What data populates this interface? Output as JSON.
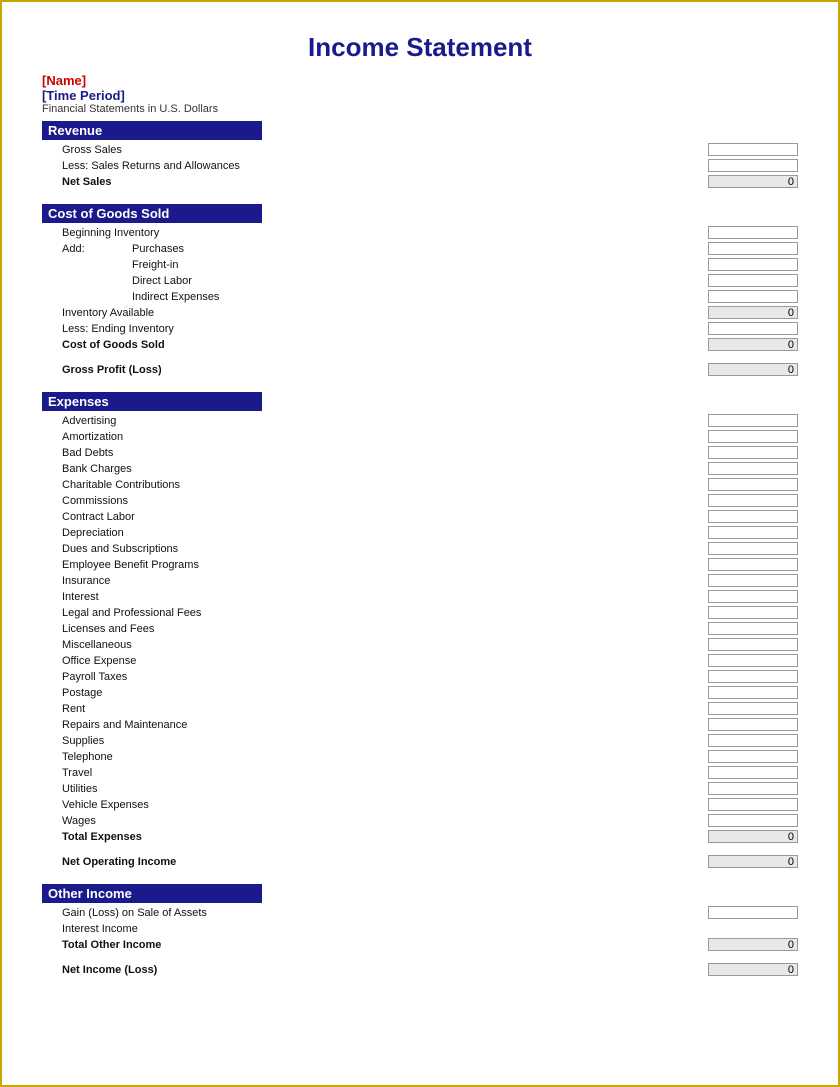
{
  "title": "Income Statement",
  "name_placeholder": "[Name]",
  "time_period_placeholder": "[Time Period]",
  "subtitle": "Financial Statements in U.S. Dollars",
  "sections": {
    "revenue": {
      "header": "Revenue",
      "items": [
        "Gross Sales",
        "Less: Sales Returns and Allowances"
      ],
      "total_label": "Net Sales",
      "total_value": "0"
    },
    "cogs": {
      "header": "Cost of Goods Sold",
      "beginning": "Beginning Inventory",
      "add_label": "Add:",
      "add_items": [
        "Purchases",
        "Freight-in",
        "Direct Labor",
        "Indirect Expenses"
      ],
      "inventory_available": "Inventory Available",
      "inventory_available_value": "0",
      "less_ending": "Less: Ending Inventory",
      "total_label": "Cost of Goods Sold",
      "total_value": "0",
      "gross_profit_label": "Gross Profit (Loss)",
      "gross_profit_value": "0"
    },
    "expenses": {
      "header": "Expenses",
      "items": [
        "Advertising",
        "Amortization",
        "Bad Debts",
        "Bank Charges",
        "Charitable Contributions",
        "Commissions",
        "Contract Labor",
        "Depreciation",
        "Dues and Subscriptions",
        "Employee Benefit Programs",
        "Insurance",
        "Interest",
        "Legal and Professional Fees",
        "Licenses and Fees",
        "Miscellaneous",
        "Office Expense",
        "Payroll Taxes",
        "Postage",
        "Rent",
        "Repairs and Maintenance",
        "Supplies",
        "Telephone",
        "Travel",
        "Utilities",
        "Vehicle Expenses",
        "Wages"
      ],
      "total_label": "Total Expenses",
      "total_value": "0",
      "net_operating_label": "Net Operating Income",
      "net_operating_value": "0"
    },
    "other_income": {
      "header": "Other Income",
      "items": [
        "Gain (Loss) on Sale of Assets",
        "Interest Income"
      ],
      "total_label": "Total Other Income",
      "total_value": "0",
      "net_income_label": "Net Income (Loss)",
      "net_income_value": "0"
    }
  }
}
